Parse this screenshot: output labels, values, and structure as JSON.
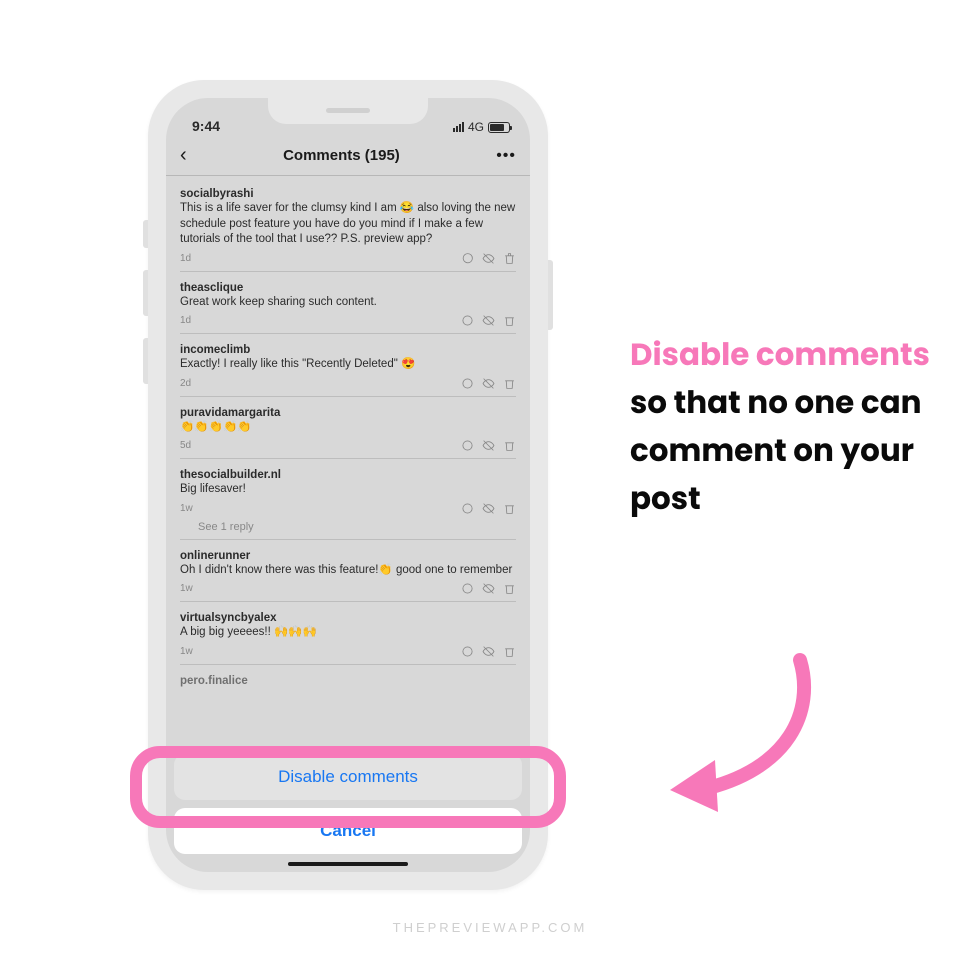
{
  "status": {
    "time": "9:44",
    "network": "4G"
  },
  "nav": {
    "title": "Comments (195)"
  },
  "comments": [
    {
      "user": "socialbyrashi",
      "text": "This is a life saver for the clumsy kind I am 😂 also loving the new schedule post feature you have do you mind if I make a few tutorials of the tool that I use?? P.S. preview app?",
      "time": "1d"
    },
    {
      "user": "theasclique",
      "text": "Great work keep sharing such content.",
      "time": "1d"
    },
    {
      "user": "incomeclimb",
      "text": "Exactly! I really like this \"Recently Deleted\" 😍",
      "time": "2d"
    },
    {
      "user": "puravidamargarita",
      "text": "👏👏👏👏👏",
      "time": "5d"
    },
    {
      "user": "thesocialbuilder.nl",
      "text": "Big lifesaver!",
      "time": "1w",
      "reply_label": "See 1 reply"
    },
    {
      "user": "onlinerunner",
      "text": "Oh I didn't know there was this feature!👏 good one to remember",
      "time": "1w"
    },
    {
      "user": "virtualsyncbyalex",
      "text": "A big big yeeees!! 🙌🙌🙌",
      "time": "1w"
    },
    {
      "user": "pero.finalice",
      "text": "",
      "time": ""
    }
  ],
  "sheet": {
    "disable_label": "Disable comments",
    "cancel_label": "Cancel"
  },
  "callout": {
    "pink": "Disable comments",
    "rest": " so that no one can comment on your post"
  },
  "watermark": "THEPREVIEWAPP.COM"
}
